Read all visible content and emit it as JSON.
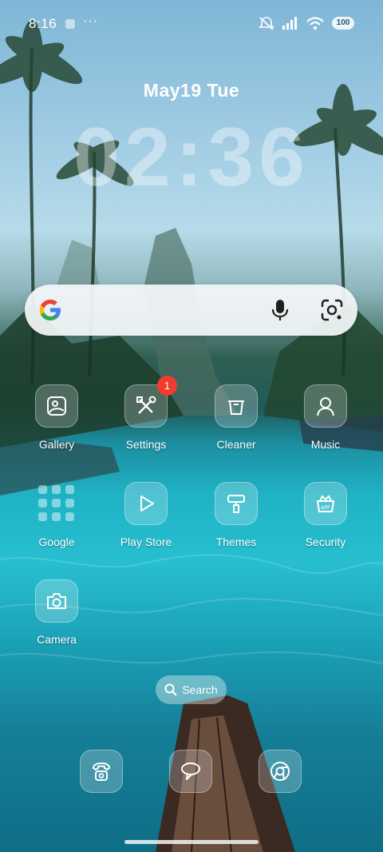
{
  "status_bar": {
    "time": "8:16",
    "more": "···",
    "battery": "100"
  },
  "lock_widget": {
    "date": "May19  Tue",
    "clock": "02:36"
  },
  "search_bar": {
    "google_logo": "google-logo-icon",
    "mic": "mic-icon",
    "lens": "lens-icon"
  },
  "apps": [
    {
      "label": "Gallery",
      "icon": "gallery-icon"
    },
    {
      "label": "Settings",
      "icon": "settings-icon",
      "badge": "1"
    },
    {
      "label": "Cleaner",
      "icon": "trash-icon"
    },
    {
      "label": "Music",
      "icon": "music-icon"
    },
    {
      "label": "Google",
      "icon": "google-folder-icon"
    },
    {
      "label": "Play Store",
      "icon": "play-store-icon"
    },
    {
      "label": "Themes",
      "icon": "paint-roller-icon"
    },
    {
      "label": "Security",
      "icon": "security-icon"
    },
    {
      "label": "Camera",
      "icon": "camera-icon"
    }
  ],
  "home_search": {
    "label": "Search"
  },
  "dock": [
    {
      "icon": "phone-icon"
    },
    {
      "icon": "messages-icon"
    },
    {
      "icon": "chrome-icon"
    }
  ],
  "colors": {
    "badge": "#f23b2c",
    "search_bar_bg": "#f4f7f9"
  }
}
